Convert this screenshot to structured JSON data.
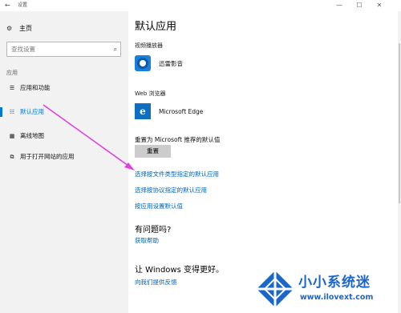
{
  "window": {
    "back_glyph": "←",
    "title": "设置",
    "min_glyph": "—",
    "max_glyph": "☐",
    "close_glyph": "✕"
  },
  "sidebar": {
    "home_label": "主页",
    "home_icon": "gear-icon",
    "search_placeholder": "查找设置",
    "section_label": "应用",
    "items": [
      {
        "label": "应用和功能",
        "icon": "list-icon",
        "active": false
      },
      {
        "label": "默认应用",
        "icon": "list-check-icon",
        "active": true
      },
      {
        "label": "离线地图",
        "icon": "map-icon",
        "active": false
      },
      {
        "label": "用于打开网站的应用",
        "icon": "window-link-icon",
        "active": false
      }
    ]
  },
  "main": {
    "title": "默认应用",
    "video_label": "视频播放器",
    "video_app": "迅雷影音",
    "web_label": "Web 浏览器",
    "web_app": "Microsoft Edge",
    "reset_label": "重置为 Microsoft 推荐的默认值",
    "reset_button": "重置",
    "links": {
      "by_file_type": "选择按文件类型指定的默认应用",
      "by_protocol": "选择按协议指定的默认应用",
      "by_app": "按应用设置默认值"
    },
    "help_heading": "有问题吗?",
    "help_link": "获取帮助",
    "better_heading": "让 Windows 变得更好。",
    "feedback_link": "向我们提供反馈"
  },
  "colors": {
    "accent": "#0078d7",
    "link": "#0062b8",
    "sidebar_bg": "#f2f2f2",
    "arrow": "#e040e0",
    "watermark": "#1b66c9"
  },
  "watermark": {
    "text_cn": "小小系统迷",
    "url": "www.ilovext.com"
  }
}
